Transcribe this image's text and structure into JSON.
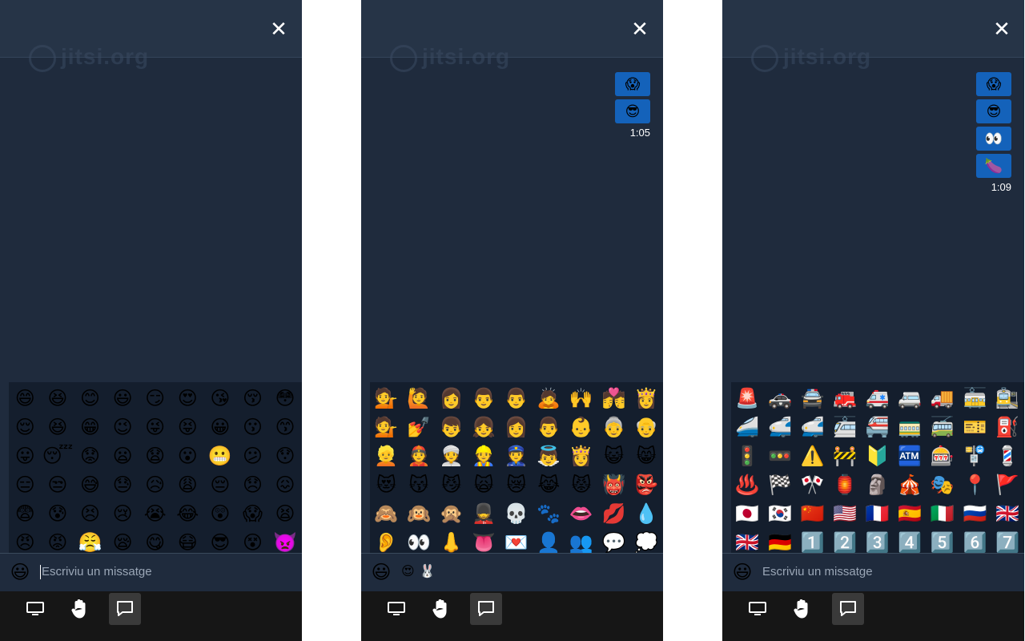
{
  "panels": [
    {
      "watermark": "jitsi.org",
      "close_icon": "✕",
      "messages": [],
      "timestamp": "",
      "input_placeholder": "Escriviu un missatge",
      "drafted_emojis": "",
      "emoji_grid": [
        "😄",
        "😆",
        "😊",
        "😃",
        "😏",
        "😍",
        "😘",
        "😚",
        "😳",
        "😌",
        "😆",
        "😁",
        "😉",
        "😜",
        "😝",
        "😀",
        "😗",
        "😙",
        "😛",
        "😴",
        "😟",
        "😦",
        "😧",
        "😮",
        "😬",
        "😕",
        "😯",
        "😑",
        "😒",
        "😅",
        "😓",
        "😥",
        "😩",
        "😔",
        "😞",
        "😖",
        "😨",
        "😰",
        "😣",
        "😢",
        "😭",
        "😂",
        "😲",
        "😱",
        "😫",
        "😠",
        "😡",
        "😤",
        "😪",
        "😋",
        "😷",
        "😎",
        "😵",
        "👿"
      ]
    },
    {
      "watermark": "jitsi.org",
      "close_icon": "✕",
      "messages": [
        "😱",
        "😎"
      ],
      "timestamp": "1:05",
      "input_placeholder": "",
      "drafted_emojis": "😍🐰",
      "emoji_grid": [
        "💁",
        "🙋",
        "👩",
        "👨",
        "👨",
        "🙇",
        "🙌",
        "💏",
        "👸",
        "💁",
        "💅",
        "👦",
        "👧",
        "👩",
        "👨",
        "👶",
        "👵",
        "👴",
        "👱",
        "👲",
        "👳",
        "👷",
        "👮",
        "👼",
        "👸",
        "😺",
        "😸",
        "😻",
        "😽",
        "😼",
        "🙀",
        "😿",
        "😹",
        "😾",
        "👹",
        "👺",
        "🙈",
        "🙉",
        "🙊",
        "💂",
        "💀",
        "🐾",
        "👄",
        "💋",
        "💧",
        "👂",
        "👀",
        "👃",
        "👅",
        "💌",
        "👤",
        "👥",
        "💬",
        "💭"
      ]
    },
    {
      "watermark": "jitsi.org",
      "close_icon": "✕",
      "messages": [
        "😱",
        "😎",
        "👀",
        "🍆"
      ],
      "timestamp": "1:09",
      "input_placeholder": "Escriviu un missatge",
      "drafted_emojis": "",
      "emoji_grid": [
        "🚨",
        "🚓",
        "🚔",
        "🚒",
        "🚑",
        "🚐",
        "🚚",
        "🚋",
        "🚉",
        "🚄",
        "🚅",
        "🚅",
        "🚈",
        "🚝",
        "🚃",
        "🚎",
        "🎫",
        "⛽",
        "🚦",
        "🚥",
        "⚠️",
        "🚧",
        "🔰",
        "🏧",
        "🎰",
        "🚏",
        "💈",
        "♨️",
        "🏁",
        "🎌",
        "🏮",
        "🗿",
        "🎪",
        "🎭",
        "📍",
        "🚩",
        "🇯🇵",
        "🇰🇷",
        "🇨🇳",
        "🇺🇸",
        "🇫🇷",
        "🇪🇸",
        "🇮🇹",
        "🇷🇺",
        "🇬🇧",
        "🇬🇧",
        "🇩🇪",
        "1️⃣",
        "2️⃣",
        "3️⃣",
        "4️⃣",
        "5️⃣",
        "6️⃣",
        "7️⃣"
      ]
    }
  ],
  "smile_button_icon": "😃",
  "toolbar": [
    "screen-share-icon",
    "raise-hand-icon",
    "chat-icon"
  ],
  "colors": {
    "panel": "#1f2b3d",
    "header": "#263447",
    "message": "#1462ba",
    "toolbar": "#161616"
  }
}
